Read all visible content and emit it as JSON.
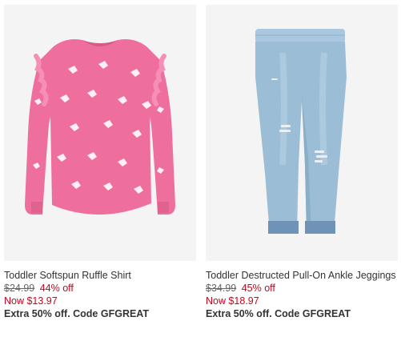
{
  "products": [
    {
      "name": "Toddler Softspun Ruffle Shirt",
      "original_price": "$24.99",
      "discount": "44% off",
      "sale_price": "Now $13.97",
      "promo": "Extra 50% off. Code GFGREAT",
      "image_icon": "pink-unicorn-shirt-image",
      "colors": {
        "garment": "#ee6f9e",
        "background": "#f4f4f4"
      }
    },
    {
      "name": "Toddler Destructed Pull-On Ankle Jeggings",
      "original_price": "$34.99",
      "discount": "45% off",
      "sale_price": "Now $18.97",
      "promo": "Extra 50% off. Code GFGREAT",
      "image_icon": "light-wash-jeggings-image",
      "colors": {
        "garment": "#9cbdd6",
        "background": "#f4f4f4"
      }
    }
  ],
  "colors": {
    "sale_red": "#d0021b",
    "text": "#333333",
    "strike": "#666666"
  }
}
